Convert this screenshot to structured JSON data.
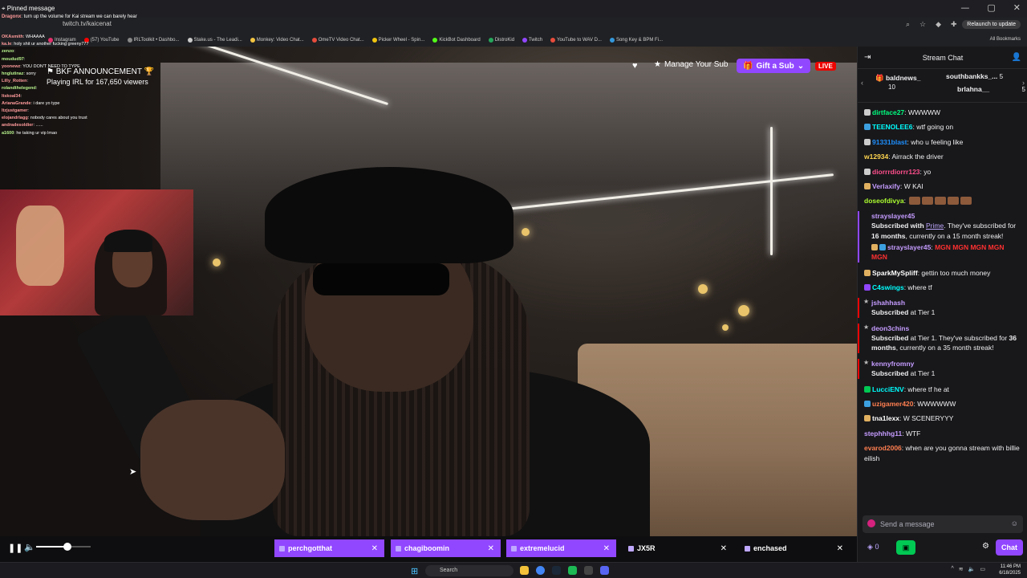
{
  "browser": {
    "url": "twitch.tv/kaicenat",
    "relaunch_label": "Relaunch to update",
    "all_bookmarks": "All Bookmarks",
    "bookmarks": [
      {
        "label": "Instagram",
        "color": "#e1306c"
      },
      {
        "label": "(57) YouTube",
        "color": "#ff0000"
      },
      {
        "label": "IRLToolkit • Dashbo...",
        "color": "#888888"
      },
      {
        "label": "Stake.us - The Leadi...",
        "color": "#cccccc"
      },
      {
        "label": "Monkey: Video Chat...",
        "color": "#f4c542"
      },
      {
        "label": "OmeTV Video Chat...",
        "color": "#e74c3c"
      },
      {
        "label": "Picker Wheel - Spin...",
        "color": "#f1c40f"
      },
      {
        "label": "KickBot Dashboard",
        "color": "#53fc18"
      },
      {
        "label": "DistroKid",
        "color": "#26a65b"
      },
      {
        "label": "Twitch",
        "color": "#9147ff"
      },
      {
        "label": "YouTube to WAV D...",
        "color": "#e74c3c"
      },
      {
        "label": "Song Key & BPM Fi...",
        "color": "#3498db"
      }
    ]
  },
  "overlay": {
    "pinned_label": "Pinned message",
    "pinned_user": "Dragonx",
    "pinned_text": ": turn up the volume for Kai stream we can barely hear",
    "lines": [
      {
        "user": "OKAsmith",
        "text": "WHAAAA",
        "green": false
      },
      {
        "user": "ka.le",
        "text": "holy shit ur another fucking greeny777",
        "green": false
      },
      {
        "user": "zenzo",
        "text": "",
        "green": true
      },
      {
        "user": "moudud97",
        "text": "",
        "green": true
      },
      {
        "user": "yoonewz",
        "text": "YOU DON'T NEED TO TYPE",
        "green": false
      },
      {
        "user": "hnglutinaz",
        "text": "sorry",
        "green": true
      },
      {
        "user": "Lilly_Rotten",
        "text": "",
        "green": false
      },
      {
        "user": "rolandthelegend",
        "text": "",
        "green": true
      },
      {
        "user": "ltskoal34",
        "text": "",
        "green": false
      },
      {
        "user": "ArianaGrande",
        "text": "i dare yo type",
        "green": false
      },
      {
        "user": "ltzjustgamer",
        "text": "",
        "green": false
      },
      {
        "user": "elojandrlagg",
        "text": "nobody cares about you trust",
        "green": false
      },
      {
        "user": "andradesoldier",
        "text": "......",
        "green": false
      },
      {
        "user": "a1600",
        "text": "he taking ur vip lmao",
        "green": true
      }
    ],
    "stream_title": "BKF ANNOUNCEMENT",
    "stream_sub": "Playing IRL for 167,650 viewers"
  },
  "player": {
    "volume_pct": 58,
    "manage_sub": "Manage Your Sub",
    "gift_sub": "Gift a Sub",
    "live": "LIVE",
    "tabs": [
      {
        "label": "perchgotthat",
        "color": "#9147ff"
      },
      {
        "label": "chagiboomin",
        "color": "#9147ff"
      },
      {
        "label": "extremelucid",
        "color": "#9147ff"
      },
      {
        "label": "JX5R",
        "color": "#0e0e10"
      },
      {
        "label": "enchased",
        "color": "#0e0e10"
      }
    ]
  },
  "chat": {
    "title": "Stream Chat",
    "gift_leaders": [
      {
        "name": "baldnews_",
        "count": "10"
      },
      {
        "name": "southbankks_...",
        "count": "5"
      },
      {
        "name": "brlahna__",
        "count": "5"
      }
    ],
    "messages": [
      {
        "user": "dirtface27",
        "color": "#00ff7f",
        "text": ": WWWWW",
        "badge": "#cccccc"
      },
      {
        "user": "TEENOLEE6",
        "color": "#00ffff",
        "text": ": wtf going on",
        "badge": "#3ca0e0"
      },
      {
        "user": "91331blast",
        "color": "#1e90ff",
        "text": ": who u feeling like",
        "badge": "#cccccc"
      },
      {
        "user": "w12934",
        "color": "#ffd54f",
        "text": ": Airrack the driver",
        "badge": ""
      },
      {
        "user": "diorrrdiorrr123",
        "color": "#ff4f8b",
        "text": ": yo",
        "badge": "#cccccc"
      },
      {
        "user": "Verlaxify",
        "color": "#c59cff",
        "text": ": W KAI",
        "badge": "#e0b060"
      },
      {
        "user": "doseofdivya",
        "color": "#adff2f",
        "text": ":",
        "badge": ""
      }
    ],
    "sub1": {
      "user": "strayslayer45",
      "line1": "Subscribed with ",
      "prime": "Prime",
      "line2": ". They've subscribed for ",
      "months": "16 months",
      "line3": ", currently on a 15 month streak!"
    },
    "sub1_msg": {
      "user": "strayslayer45",
      "text": "MGN MGN MGN MGN MGN"
    },
    "messages2": [
      {
        "user": "SparkMySpliff",
        "color": "#ffffff",
        "text": ": gettin too much money",
        "badge": "#e0b060"
      },
      {
        "user": "C4swings",
        "color": "#00ffff",
        "text": ": where tf",
        "badge": "#9147ff"
      }
    ],
    "sub2": {
      "user": "jshahhash",
      "text": "Subscribed",
      "tier": " at Tier 1"
    },
    "sub3": {
      "user": "deon3chins",
      "text": "Subscribed",
      "tier": " at Tier 1. They've subscribed for ",
      "months": "36 months",
      "rest": ", currently on a 35 month streak!"
    },
    "sub4": {
      "user": "kennyfromny",
      "text": "Subscribed",
      "tier": " at Tier 1"
    },
    "messages3": [
      {
        "user": "LucciENV",
        "color": "#00ffff",
        "text": ": where tf he at",
        "badge": "#00c853"
      },
      {
        "user": "uzigamer420",
        "color": "#ff7f50",
        "text": ": WWWWWW",
        "badge": "#3ca0e0"
      },
      {
        "user": "tna1lexx",
        "color": "#ffffff",
        "text": ": W SCENERYYY",
        "badge": "#e0b060"
      },
      {
        "user": "stephhhg11",
        "color": "#c59cff",
        "text": ": WTF",
        "badge": ""
      },
      {
        "user": "evarod2006",
        "color": "#ff7f50",
        "text": ": when are you gonna stream with billie eilish",
        "badge": ""
      }
    ],
    "input_placeholder": "Send a message",
    "points": "0",
    "chat_button": "Chat"
  },
  "taskbar": {
    "search": "Search",
    "time": "11:46 PM",
    "date": "6/18/2025"
  }
}
